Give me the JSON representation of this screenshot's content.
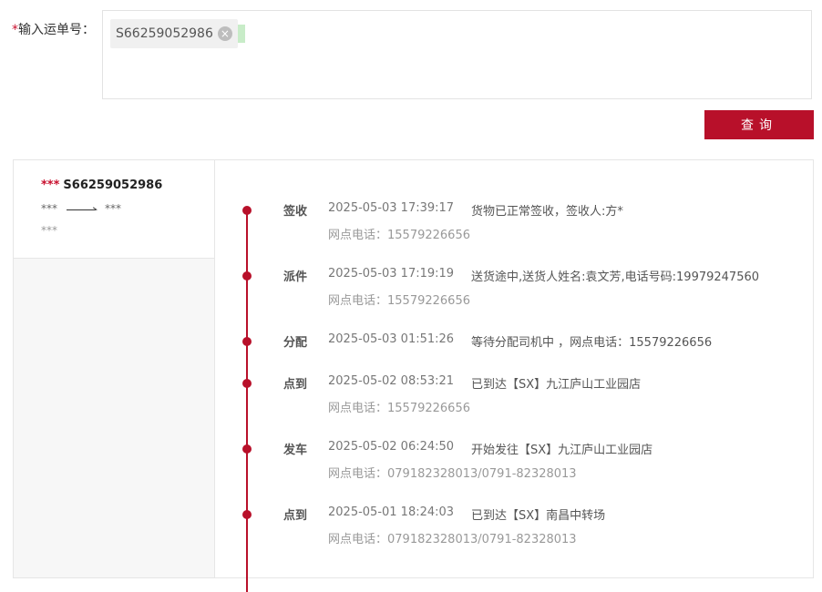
{
  "form": {
    "required_mark": "*",
    "label": "输入运单号：",
    "tag_value": "S66259052986",
    "tag_close_glyph": "×",
    "search_label": "查询"
  },
  "summary": {
    "masked": "***",
    "waybill": "S66259052986",
    "from": "***",
    "to": "***",
    "extra": "***"
  },
  "events": [
    {
      "status": "签收",
      "time": "2025-05-03 17:39:17",
      "desc": "货物已正常签收，签收人:方*",
      "phone": "网点电话：15579226656"
    },
    {
      "status": "派件",
      "time": "2025-05-03 17:19:19",
      "desc": "送货途中,送货人姓名:袁文芳,电话号码:19979247560",
      "phone": "网点电话：15579226656"
    },
    {
      "status": "分配",
      "time": "2025-05-03 01:51:26",
      "desc": "等待分配司机中 ，网点电话：15579226656",
      "phone": ""
    },
    {
      "status": "点到",
      "time": "2025-05-02 08:53:21",
      "desc": "已到达【SX】九江庐山工业园店",
      "phone": "网点电话：15579226656"
    },
    {
      "status": "发车",
      "time": "2025-05-02 06:24:50",
      "desc": "开始发往【SX】九江庐山工业园店",
      "phone": "网点电话：079182328013/0791-82328013"
    },
    {
      "status": "点到",
      "time": "2025-05-01 18:24:03",
      "desc": "已到达【SX】南昌中转场",
      "phone": "网点电话：079182328013/0791-82328013"
    }
  ],
  "colors": {
    "accent": "#b8102a"
  }
}
